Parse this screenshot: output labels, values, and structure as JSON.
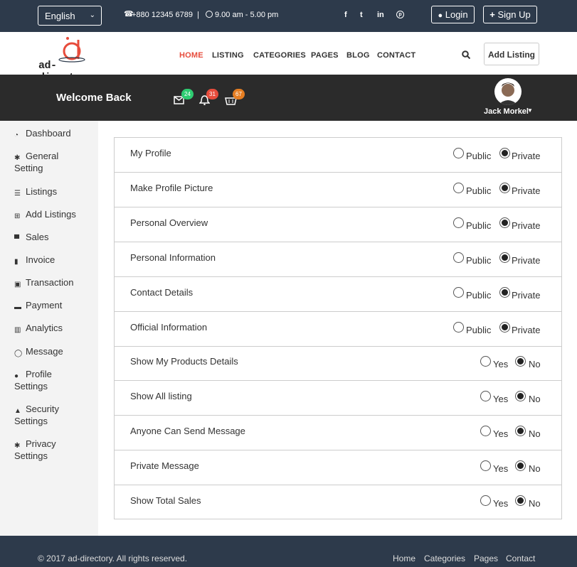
{
  "topbar": {
    "language": "English",
    "phone": "+880 12345 6789",
    "separator": "|",
    "hours": "9.00 am - 5.00 pm",
    "social": [
      "f",
      "t",
      "in",
      "p"
    ],
    "login": "Login",
    "signup": "Sign Up"
  },
  "brand": {
    "logo_text": "ad-directory"
  },
  "nav": {
    "items": [
      "HOME",
      "LISTING",
      "CATEGORIES",
      "PAGES",
      "BLOG",
      "CONTACT"
    ],
    "active_color": "#e74c3c",
    "add_listing": "Add Listing"
  },
  "welcome": {
    "title": "Welcome Back",
    "mail_count": "24",
    "notif_count": "31",
    "cart_count": "67",
    "user_name": "Jack Morkel"
  },
  "sidebar": {
    "items": [
      {
        "label": "Dashboard",
        "line2": "",
        "icon": "dashboard-icon"
      },
      {
        "label": "General",
        "line2": "Setting",
        "icon": "gear-icon"
      },
      {
        "label": "Listings",
        "line2": "",
        "icon": "list-icon"
      },
      {
        "label": "Add Listings",
        "line2": "",
        "icon": "plus-square-icon"
      },
      {
        "label": "Sales",
        "line2": "",
        "icon": "cart-icon"
      },
      {
        "label": "Invoice",
        "line2": "",
        "icon": "file-icon"
      },
      {
        "label": "Transaction",
        "line2": "",
        "icon": "money-icon"
      },
      {
        "label": "Payment",
        "line2": "",
        "icon": "credit-card-icon"
      },
      {
        "label": "Analytics",
        "line2": "",
        "icon": "bar-chart-icon"
      },
      {
        "label": "Message",
        "line2": "",
        "icon": "comment-icon"
      },
      {
        "label": "Profile",
        "line2": "Settings",
        "icon": "user-icon"
      },
      {
        "label": "Security",
        "line2": "Settings",
        "icon": "lock-icon"
      },
      {
        "label": "Privacy",
        "line2": "Settings",
        "icon": "gear-icon"
      }
    ]
  },
  "privacy": {
    "rows": [
      {
        "label": "My Profile",
        "opt1": "Public",
        "opt2": "Private",
        "selected": 2
      },
      {
        "label": "Make Profile Picture",
        "opt1": "Public",
        "opt2": "Private",
        "selected": 2
      },
      {
        "label": "Personal Overview",
        "opt1": "Public",
        "opt2": "Private",
        "selected": 2
      },
      {
        "label": "Personal Information",
        "opt1": "Public",
        "opt2": "Private",
        "selected": 2
      },
      {
        "label": "Contact Details",
        "opt1": "Public",
        "opt2": "Private",
        "selected": 2
      },
      {
        "label": "Official Information",
        "opt1": "Public",
        "opt2": "Private",
        "selected": 2
      },
      {
        "label": "Show My Products Details",
        "opt1": "Yes",
        "opt2": "No",
        "selected": 2
      },
      {
        "label": "Show All listing",
        "opt1": "Yes",
        "opt2": "No",
        "selected": 2
      },
      {
        "label": "Anyone Can Send Message",
        "opt1": "Yes",
        "opt2": "No",
        "selected": 2
      },
      {
        "label": "Private Message",
        "opt1": "Yes",
        "opt2": "No",
        "selected": 2
      },
      {
        "label": "Show Total Sales",
        "opt1": "Yes",
        "opt2": "No",
        "selected": 2
      }
    ]
  },
  "footer": {
    "copyright": "© 2017 ad-directory. All rights reserved.",
    "links": [
      "Home",
      "Categories",
      "Pages",
      "Contact"
    ]
  }
}
